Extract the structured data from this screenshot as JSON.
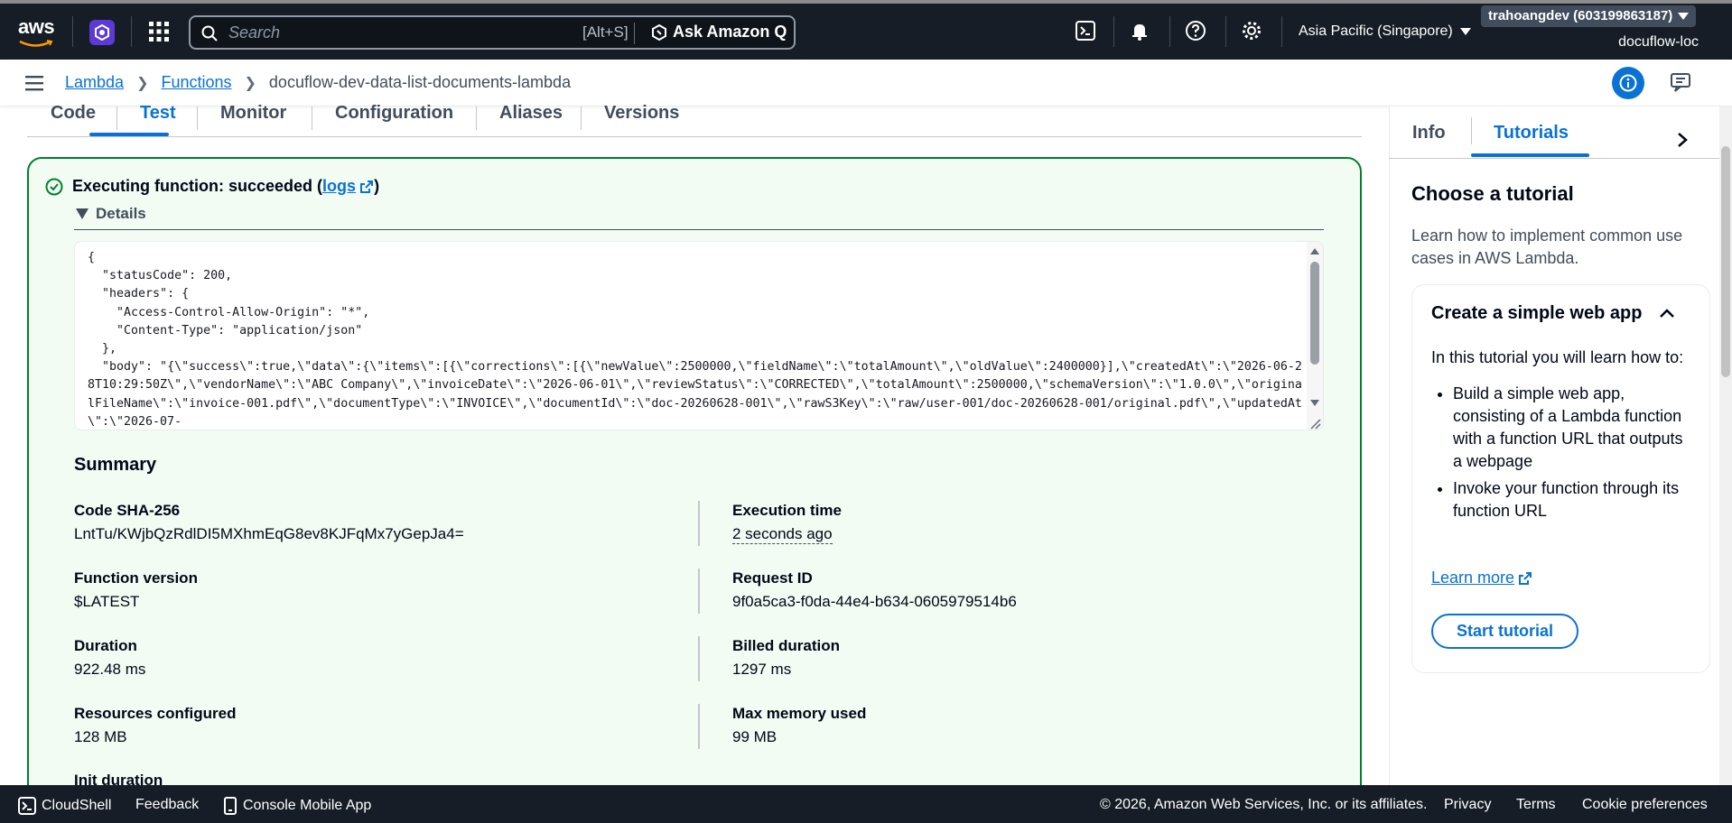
{
  "nav": {
    "brand": "aws",
    "search_placeholder": "Search",
    "search_shortcut": "[Alt+S]",
    "ask_q": "Ask Amazon Q",
    "region": "Asia Pacific (Singapore)",
    "account": "trahoangdev (603199863187)",
    "user": "docuflow-loc",
    "colors": {
      "bg": "#161d26",
      "accent": "#0972d3",
      "success": "#00802f"
    }
  },
  "breadcrumb": {
    "items": [
      "Lambda",
      "Functions"
    ],
    "current": "docuflow-dev-data-list-documents-lambda"
  },
  "tabs": [
    "Code",
    "Test",
    "Monitor",
    "Configuration",
    "Aliases",
    "Versions"
  ],
  "result": {
    "status_prefix": "Executing function: succeeded (",
    "logs_link": "logs",
    "status_suffix": ")",
    "details_label": "Details",
    "json_output": "{\n  \"statusCode\": 200,\n  \"headers\": {\n    \"Access-Control-Allow-Origin\": \"*\",\n    \"Content-Type\": \"application/json\"\n  },\n  \"body\": \"{\\\"success\\\":true,\\\"data\\\":{\\\"items\\\":[{\\\"corrections\\\":[{\\\"newValue\\\":2500000,\\\"fieldName\\\":\\\"totalAmount\\\",\\\"oldValue\\\":2400000}],\\\"createdAt\\\":\\\"2026-06-28T10:29:50Z\\\",\\\"vendorName\\\":\\\"ABC Company\\\",\\\"invoiceDate\\\":\\\"2026-06-01\\\",\\\"reviewStatus\\\":\\\"CORRECTED\\\",\\\"totalAmount\\\":2500000,\\\"schemaVersion\\\":\\\"1.0.0\\\",\\\"originalFileName\\\":\\\"invoice-001.pdf\\\",\\\"documentType\\\":\\\"INVOICE\\\",\\\"documentId\\\":\\\"doc-20260628-001\\\",\\\"rawS3Key\\\":\\\"raw/user-001/doc-20260628-001/original.pdf\\\",\\\"updatedAt\\\":\\\"2026-07-"
  },
  "summary": {
    "title": "Summary",
    "code_sha_label": "Code SHA-256",
    "code_sha": "LntTu/KWjbQzRdlDI5MXhmEqG8ev8KJFqMx7yGepJa4=",
    "exec_time_label": "Execution time",
    "exec_time": "2 seconds ago",
    "fn_version_label": "Function version",
    "fn_version": "$LATEST",
    "request_id_label": "Request ID",
    "request_id": "9f0a5ca3-f0da-44e4-b634-0605979514b6",
    "duration_label": "Duration",
    "duration": "922.48 ms",
    "billed_label": "Billed duration",
    "billed": "1297 ms",
    "resources_label": "Resources configured",
    "resources": "128 MB",
    "max_mem_label": "Max memory used",
    "max_mem": "99 MB",
    "init_label": "Init duration"
  },
  "panel": {
    "tabs": [
      "Info",
      "Tutorials"
    ],
    "title": "Choose a tutorial",
    "desc": "Learn how to implement common use cases in AWS Lambda.",
    "card_title": "Create a simple web app",
    "card_intro": "In this tutorial you will learn how to:",
    "bullets": [
      "Build a simple web app, consisting of a Lambda function with a function URL that outputs a webpage",
      "Invoke your function through its function URL"
    ],
    "learn_more": "Learn more",
    "start_btn": "Start tutorial"
  },
  "footer": {
    "cloudshell": "CloudShell",
    "feedback": "Feedback",
    "mobile": "Console Mobile App",
    "copyright": "© 2026, Amazon Web Services, Inc. or its affiliates.",
    "privacy": "Privacy",
    "terms": "Terms",
    "cookies": "Cookie preferences"
  }
}
